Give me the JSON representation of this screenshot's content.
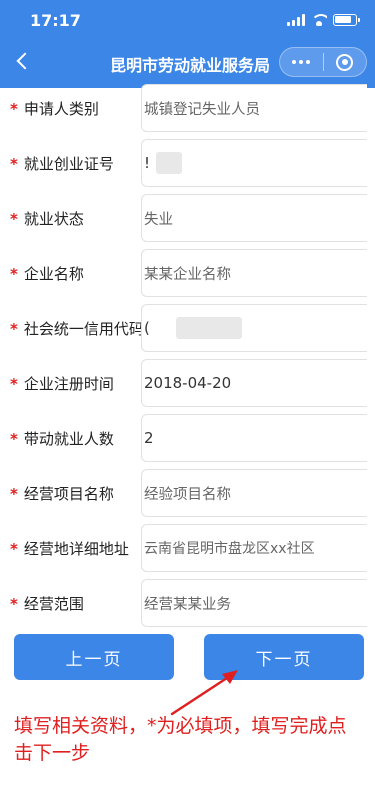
{
  "status_bar": {
    "time": "17:17"
  },
  "navbar": {
    "title": "昆明市劳动就业服务局"
  },
  "form": {
    "rows": [
      {
        "label": "申请人类别",
        "value": "城镇登记失业人员",
        "required": true
      },
      {
        "label": "就业创业证号",
        "value": "!",
        "required": true
      },
      {
        "label": "就业状态",
        "value": "失业",
        "required": true
      },
      {
        "label": "企业名称",
        "value": "某某企业名称",
        "required": true
      },
      {
        "label": "社会统一信用代码",
        "value": "(",
        "required": true
      },
      {
        "label": "企业注册时间",
        "value": "2018-04-20",
        "required": true
      },
      {
        "label": "带动就业人数",
        "value": "2",
        "required": true
      },
      {
        "label": "经营项目名称",
        "value": "经验项目名称",
        "required": true
      },
      {
        "label": "经营地详细地址",
        "value": "云南省昆明市盘龙区xx社区",
        "required": true
      },
      {
        "label": "经营范围",
        "value": "经营某某业务",
        "required": true
      }
    ],
    "required_mark": "*"
  },
  "buttons": {
    "prev": "上一页",
    "next": "下一页"
  },
  "annotation": {
    "text": "填写相关资料，*为必填项，填写完成点击下一步"
  },
  "colors": {
    "primary": "#3c86e8",
    "required": "#e02020",
    "annotation": "#e02020"
  }
}
